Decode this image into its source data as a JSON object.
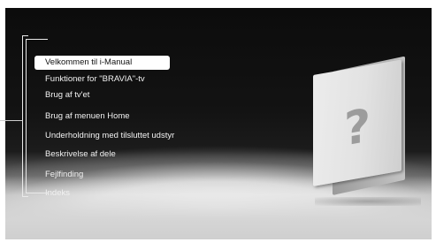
{
  "menu": {
    "items": [
      {
        "label": "Velkommen til i-Manual",
        "selected": true
      },
      {
        "label": "Funktioner for \"BRAVIA\"-tv",
        "selected": false
      },
      {
        "label": "Brug af tv'et",
        "selected": false
      },
      {
        "label": "Brug af menuen Home",
        "selected": false
      },
      {
        "label": "Underholdning med tilsluttet udstyr",
        "selected": false
      },
      {
        "label": "Beskrivelse af dele",
        "selected": false
      },
      {
        "label": "Fejlfinding",
        "selected": false
      },
      {
        "label": "Indeks",
        "selected": false
      }
    ]
  },
  "illustration": {
    "icon": "question-book-icon",
    "glyph": "?"
  },
  "colors": {
    "background": "#111111",
    "highlight": "#ffffff",
    "text": "#f2f2f2"
  }
}
